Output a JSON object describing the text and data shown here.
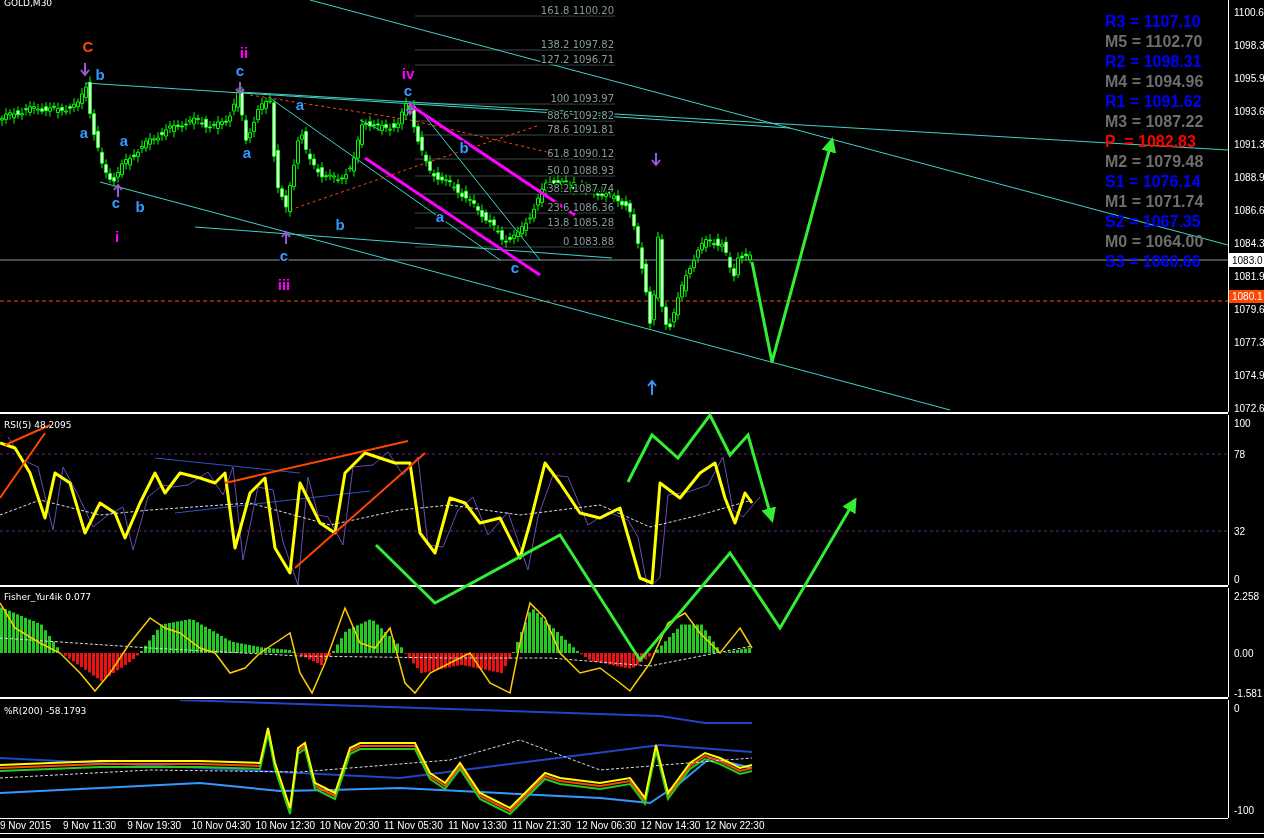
{
  "window": {
    "title": "GOLD,M30"
  },
  "main_chart": {
    "wave_labels": [
      {
        "text": "C",
        "color": "#ff4500"
      },
      {
        "text": "b",
        "color": "#3399ff"
      },
      {
        "text": "a",
        "color": "#3399ff"
      },
      {
        "text": "a",
        "color": "#3399ff"
      },
      {
        "text": "c",
        "color": "#3399ff"
      },
      {
        "text": "b",
        "color": "#3399ff"
      },
      {
        "text": "i",
        "color": "#ff00ff"
      },
      {
        "text": "ii",
        "color": "#ff00ff"
      },
      {
        "text": "c",
        "color": "#3399ff"
      },
      {
        "text": "a",
        "color": "#3399ff"
      },
      {
        "text": "a",
        "color": "#3399ff"
      },
      {
        "text": "b",
        "color": "#3399ff"
      },
      {
        "text": "c",
        "color": "#3399ff"
      },
      {
        "text": "iii",
        "color": "#ff00ff"
      },
      {
        "text": "iv",
        "color": "#ff00ff"
      },
      {
        "text": "c",
        "color": "#3399ff"
      },
      {
        "text": "b",
        "color": "#3399ff"
      },
      {
        "text": "a",
        "color": "#3399ff"
      },
      {
        "text": "c",
        "color": "#3399ff"
      }
    ],
    "fib_levels": [
      "161.8 1100.20",
      "138.2 1097.82",
      "127.2 1096.71",
      "100 1093.97",
      "88.6 1092.82",
      "78.6 1091.81",
      "61.8 1090.12",
      "50.0 1088.93",
      "38.2 1087.74",
      "23.6 1086.36",
      "13.8 1085.28",
      "0 1083.88"
    ],
    "pivot_levels": [
      {
        "text": "R3 = 1107.10",
        "color": "#0000ff"
      },
      {
        "text": "M5 = 1102.70",
        "color": "#6e6e6e"
      },
      {
        "text": "R2 = 1098.31",
        "color": "#0000ff"
      },
      {
        "text": "M4 = 1094.96",
        "color": "#6e6e6e"
      },
      {
        "text": "R1 = 1091.62",
        "color": "#0000ff"
      },
      {
        "text": "M3 = 1087.22",
        "color": "#6e6e6e"
      },
      {
        "text": "P  = 1082.83",
        "color": "#ff0000"
      },
      {
        "text": "M2 = 1079.48",
        "color": "#6e6e6e"
      },
      {
        "text": "S1 = 1076.14",
        "color": "#0000ff"
      },
      {
        "text": "M1 = 1071.74",
        "color": "#6e6e6e"
      },
      {
        "text": "S2 = 1067.35",
        "color": "#0000ff"
      },
      {
        "text": "M0 = 1064.00",
        "color": "#6e6e6e"
      },
      {
        "text": "S3 = 1060.66",
        "color": "#0000ff"
      }
    ],
    "price_axis": [
      "1100.6",
      "1098.3",
      "1095.9",
      "1093.6",
      "1091.3",
      "1088.9",
      "1086.6",
      "1084.3",
      "1081.9",
      "1079.6",
      "1077.3",
      "1074.9",
      "1072.6"
    ],
    "current_price": "1083.0",
    "line_price": "1080.1"
  },
  "rsi": {
    "title": "RSI(5) 48.2095",
    "axis": [
      "100",
      "78",
      "32",
      "0"
    ]
  },
  "fisher": {
    "title": "Fisher_Yur4ik 0.077",
    "axis": [
      "2.258",
      "0.00",
      "-1.581"
    ]
  },
  "williams": {
    "title": "%R(200) -58.1793",
    "axis": [
      "0",
      "-100"
    ]
  },
  "time_axis": [
    "9 Nov 2015",
    "9 Nov 11:30",
    "9 Nov 19:30",
    "10 Nov 04:30",
    "10 Nov 12:30",
    "10 Nov 20:30",
    "11 Nov 05:30",
    "11 Nov 13:30",
    "11 Nov 21:30",
    "12 Nov 06:30",
    "12 Nov 14:30",
    "12 Nov 22:30"
  ]
}
